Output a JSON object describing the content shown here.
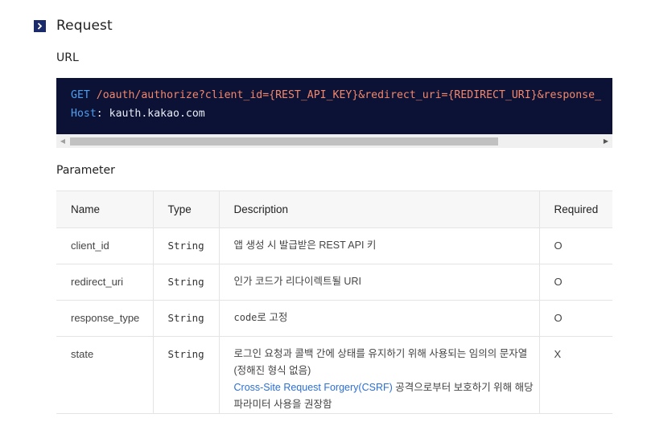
{
  "section": {
    "title": "Request",
    "icon": "chevron-right-icon"
  },
  "url": {
    "title": "URL",
    "code": {
      "method": "GET",
      "path": "/oauth/authorize?client_id={REST_API_KEY}&redirect_uri={REDIRECT_URI}&response_",
      "host_key": "Host",
      "host_sep": ": ",
      "host_value": "kauth.kakao.com"
    }
  },
  "parameter": {
    "title": "Parameter",
    "headers": [
      "Name",
      "Type",
      "Description",
      "Required"
    ],
    "rows": [
      {
        "name": "client_id",
        "type": "String",
        "desc": "앱 생성 시 발급받은 REST API 키",
        "required": "O"
      },
      {
        "name": "redirect_uri",
        "type": "String",
        "desc": "인가 코드가 리다이렉트될 URI",
        "required": "O"
      },
      {
        "name": "response_type",
        "type": "String",
        "desc_code": "code",
        "desc": "로 고정",
        "required": "O"
      },
      {
        "name": "state",
        "type": "String",
        "desc_line1": "로그인 요청과 콜백 간에 상태를 유지하기 위해 사용되는 임의의 문자열",
        "desc_line2": "(정해진 형식 없음)",
        "desc_link": "Cross-Site Request Forgery(CSRF)",
        "desc_line3": " 공격으로부터 보호하기 위해 해당",
        "desc_line4": "파라미터 사용을 권장함",
        "required": "X"
      }
    ]
  },
  "colors": {
    "code_bg": "#0c1235",
    "keyword": "#4e9ef0",
    "path": "#f2876b",
    "link": "#2a6fd6",
    "chevron_box": "#1b2a6b"
  }
}
